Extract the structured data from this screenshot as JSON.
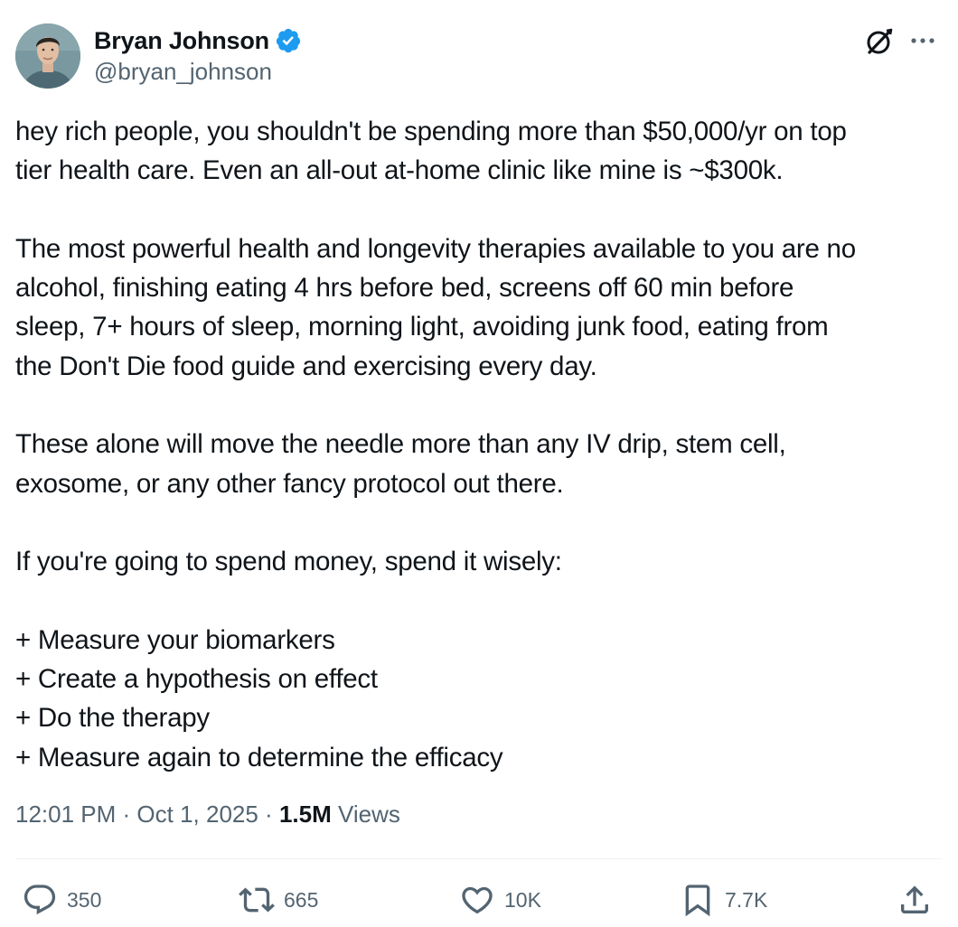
{
  "author": {
    "display_name": "Bryan Johnson",
    "handle": "@bryan_johnson",
    "verified": true
  },
  "icons": {
    "verified": "verified-badge-icon",
    "grok": "grok-icon",
    "more": "more-icon",
    "reply": "reply-icon",
    "repost": "repost-icon",
    "like": "heart-icon",
    "bookmark": "bookmark-icon",
    "share": "share-icon"
  },
  "colors": {
    "verified_blue": "#1d9bf0",
    "text": "#0f1419",
    "secondary_text": "#536471",
    "divider": "#eff3f4"
  },
  "tweet": {
    "paragraphs": [
      {
        "lines": [
          "hey rich people, you shouldn't be spending more than $50,000/yr on top",
          "tier health care. Even an all-out at-home clinic like mine is ~$300k."
        ]
      },
      {
        "lines": [
          "The most powerful health and longevity therapies available to you are no",
          "alcohol, finishing eating 4 hrs before bed, screens off 60 min before",
          "sleep, 7+ hours of sleep, morning light, avoiding junk food, eating from",
          "the Don't Die food guide and exercising every day."
        ]
      },
      {
        "lines": [
          "These alone will move the needle more than any IV drip, stem cell,",
          "exosome, or any other fancy protocol out there."
        ]
      },
      {
        "lines": [
          "If you're going to spend money, spend it wisely:"
        ]
      },
      {
        "lines": [
          "+ Measure your biomarkers",
          "+ Create a hypothesis on effect",
          "+ Do the therapy",
          "+ Measure again to determine the efficacy"
        ]
      }
    ]
  },
  "meta": {
    "time": "12:01 PM",
    "separator": " · ",
    "date": "Oct 1, 2025",
    "views_count": "1.5M",
    "views_label": " Views"
  },
  "actions": {
    "replies": "350",
    "reposts": "665",
    "likes": "10K",
    "bookmarks": "7.7K"
  }
}
